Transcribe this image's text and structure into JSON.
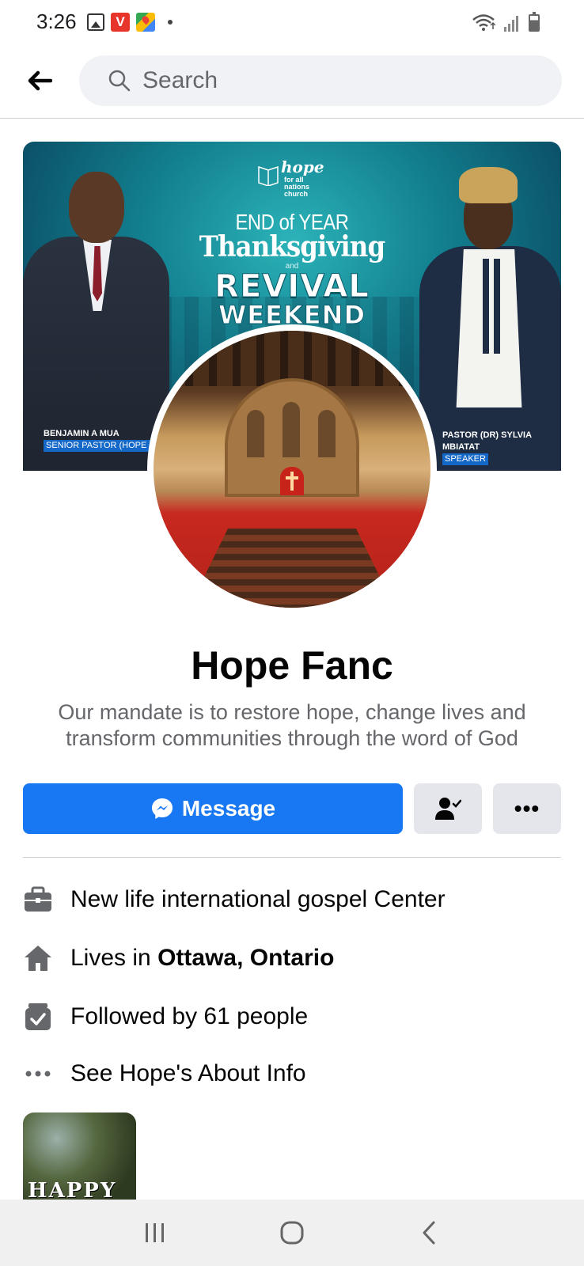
{
  "status_bar": {
    "time": "3:26",
    "icons_left": [
      "image-icon",
      "vivaldi-icon",
      "maps-icon",
      "dot-icon"
    ],
    "icons_right": [
      "wifi-icon",
      "signal-icon",
      "battery-icon"
    ]
  },
  "header": {
    "back_icon": "arrow-left-icon",
    "search_placeholder": "Search"
  },
  "cover": {
    "logo_main": "hope",
    "logo_sub": [
      "for all",
      "nations",
      "church"
    ],
    "line1": "END of YEAR",
    "line2": "Thanksgiving",
    "and_text": "and",
    "line3": "REVIVAL",
    "line4": "WEEKEND",
    "left_name": "BENJAMIN A MUA",
    "left_role": "SENIOR PASTOR (HOPE FANC)",
    "right_name": "PASTOR (DR) SYLVIA MBIATAT",
    "right_role": "SPEAKER"
  },
  "profile": {
    "name": "Hope Fanc",
    "bio": "Our mandate is to restore hope, change lives and transform communities through the word of God"
  },
  "actions": {
    "message_label": "Message",
    "follow_icon": "person-check-icon",
    "more_label": "•••"
  },
  "info": {
    "work": "New life international gospel Center",
    "lives_prefix": "Lives in ",
    "lives_place": "Ottawa, Ontario",
    "followers": "Followed by 61 people",
    "about": "See Hope's About Info"
  },
  "thumbnail": {
    "text": "HAPPY"
  },
  "colors": {
    "primary": "#1877f2",
    "secondary_btn": "#e4e6eb",
    "text_secondary": "#65676b"
  }
}
